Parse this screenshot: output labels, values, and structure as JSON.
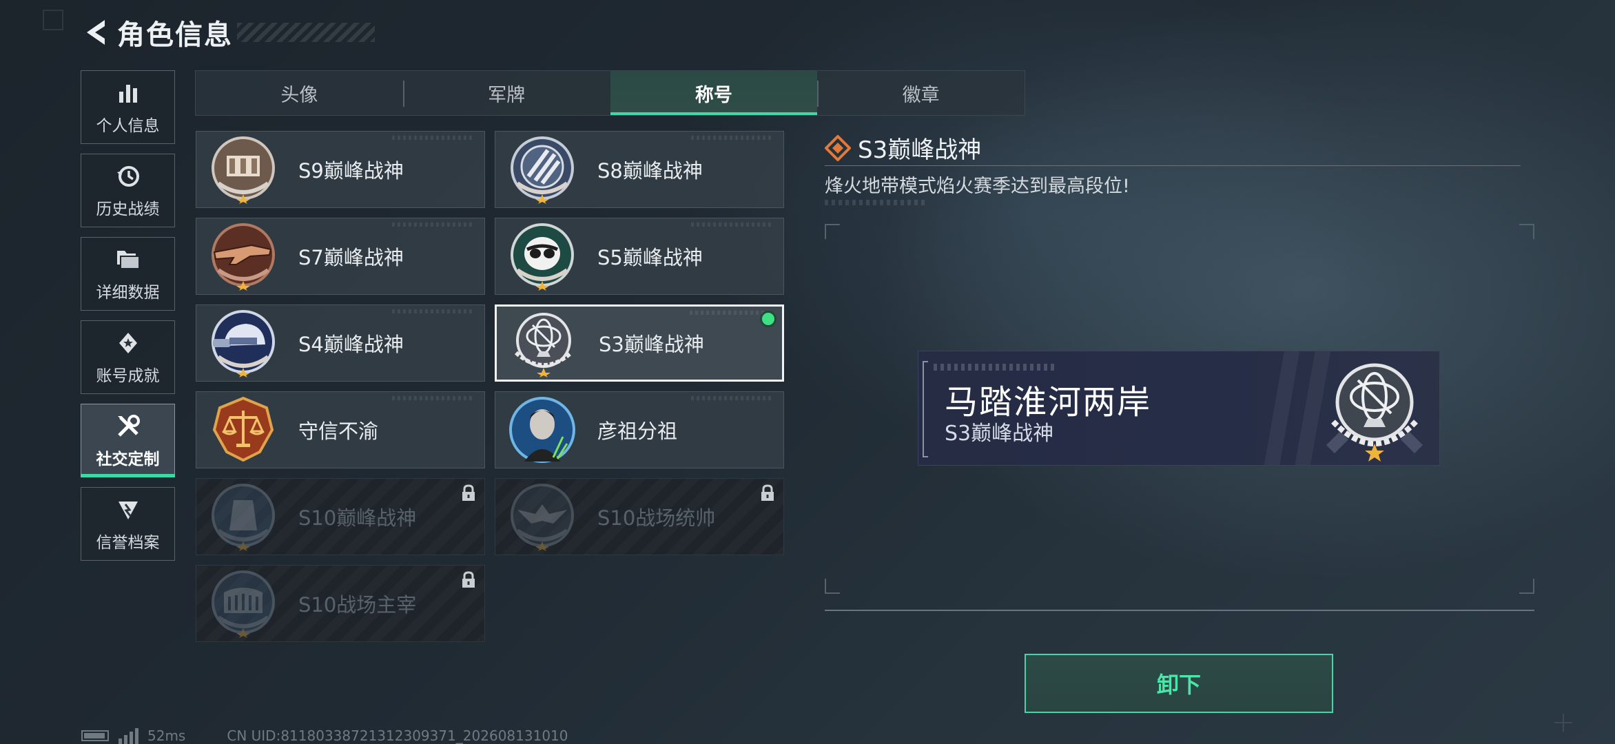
{
  "header": {
    "title": "角色信息"
  },
  "sidebar": {
    "items": [
      {
        "label": "个人信息",
        "icon": "bar-chart-icon",
        "active": false
      },
      {
        "label": "历史战绩",
        "icon": "history-clock-icon",
        "active": false
      },
      {
        "label": "详细数据",
        "icon": "folder-icon",
        "active": false
      },
      {
        "label": "账号成就",
        "icon": "achievement-icon",
        "active": false
      },
      {
        "label": "社交定制",
        "icon": "tools-icon",
        "active": true
      },
      {
        "label": "信誉档案",
        "icon": "credit-badge-icon",
        "active": false
      }
    ]
  },
  "tabs": [
    {
      "label": "头像",
      "active": false
    },
    {
      "label": "军牌",
      "active": false
    },
    {
      "label": "称号",
      "active": true
    },
    {
      "label": "徽章",
      "active": false
    }
  ],
  "titles": [
    {
      "label": "S9巅峰战神",
      "emblem": "fortress-emblem-icon",
      "locked": false,
      "selected": false
    },
    {
      "label": "S8巅峰战神",
      "emblem": "stripes-emblem-icon",
      "locked": false,
      "selected": false
    },
    {
      "label": "S7巅峰战神",
      "emblem": "rifle-emblem-icon",
      "locked": false,
      "selected": false
    },
    {
      "label": "S5巅峰战神",
      "emblem": "skull-emblem-icon",
      "locked": false,
      "selected": false
    },
    {
      "label": "S4巅峰战神",
      "emblem": "helmet-emblem-icon",
      "locked": false,
      "selected": false
    },
    {
      "label": "S3巅峰战神",
      "emblem": "armillary-emblem-icon",
      "locked": false,
      "selected": true
    },
    {
      "label": "守信不渝",
      "emblem": "scales-emblem-icon",
      "locked": false,
      "selected": false
    },
    {
      "label": "彦祖分祖",
      "emblem": "portrait-emblem-icon",
      "locked": false,
      "selected": false
    },
    {
      "label": "S10巅峰战神",
      "emblem": "tower-emblem-icon",
      "locked": true,
      "selected": false
    },
    {
      "label": "S10战场统帅",
      "emblem": "eagle-emblem-icon",
      "locked": true,
      "selected": false
    },
    {
      "label": "S10战场主宰",
      "emblem": "colosseum-emblem-icon",
      "locked": true,
      "selected": false
    }
  ],
  "detail": {
    "title": "S3巅峰战神",
    "description": "烽火地带模式焰火赛季达到最高段位!",
    "preview_name": "马踏淮河两岸",
    "preview_title": "S3巅峰战神",
    "unequip_label": "卸下"
  },
  "footer": {
    "ping": "52ms",
    "uid": "CN UID:81180338721312309371_202608131010"
  },
  "colors": {
    "accent": "#3fd9a6",
    "selected_dot": "#3fe083",
    "title_diamond": "#e07a3a"
  }
}
